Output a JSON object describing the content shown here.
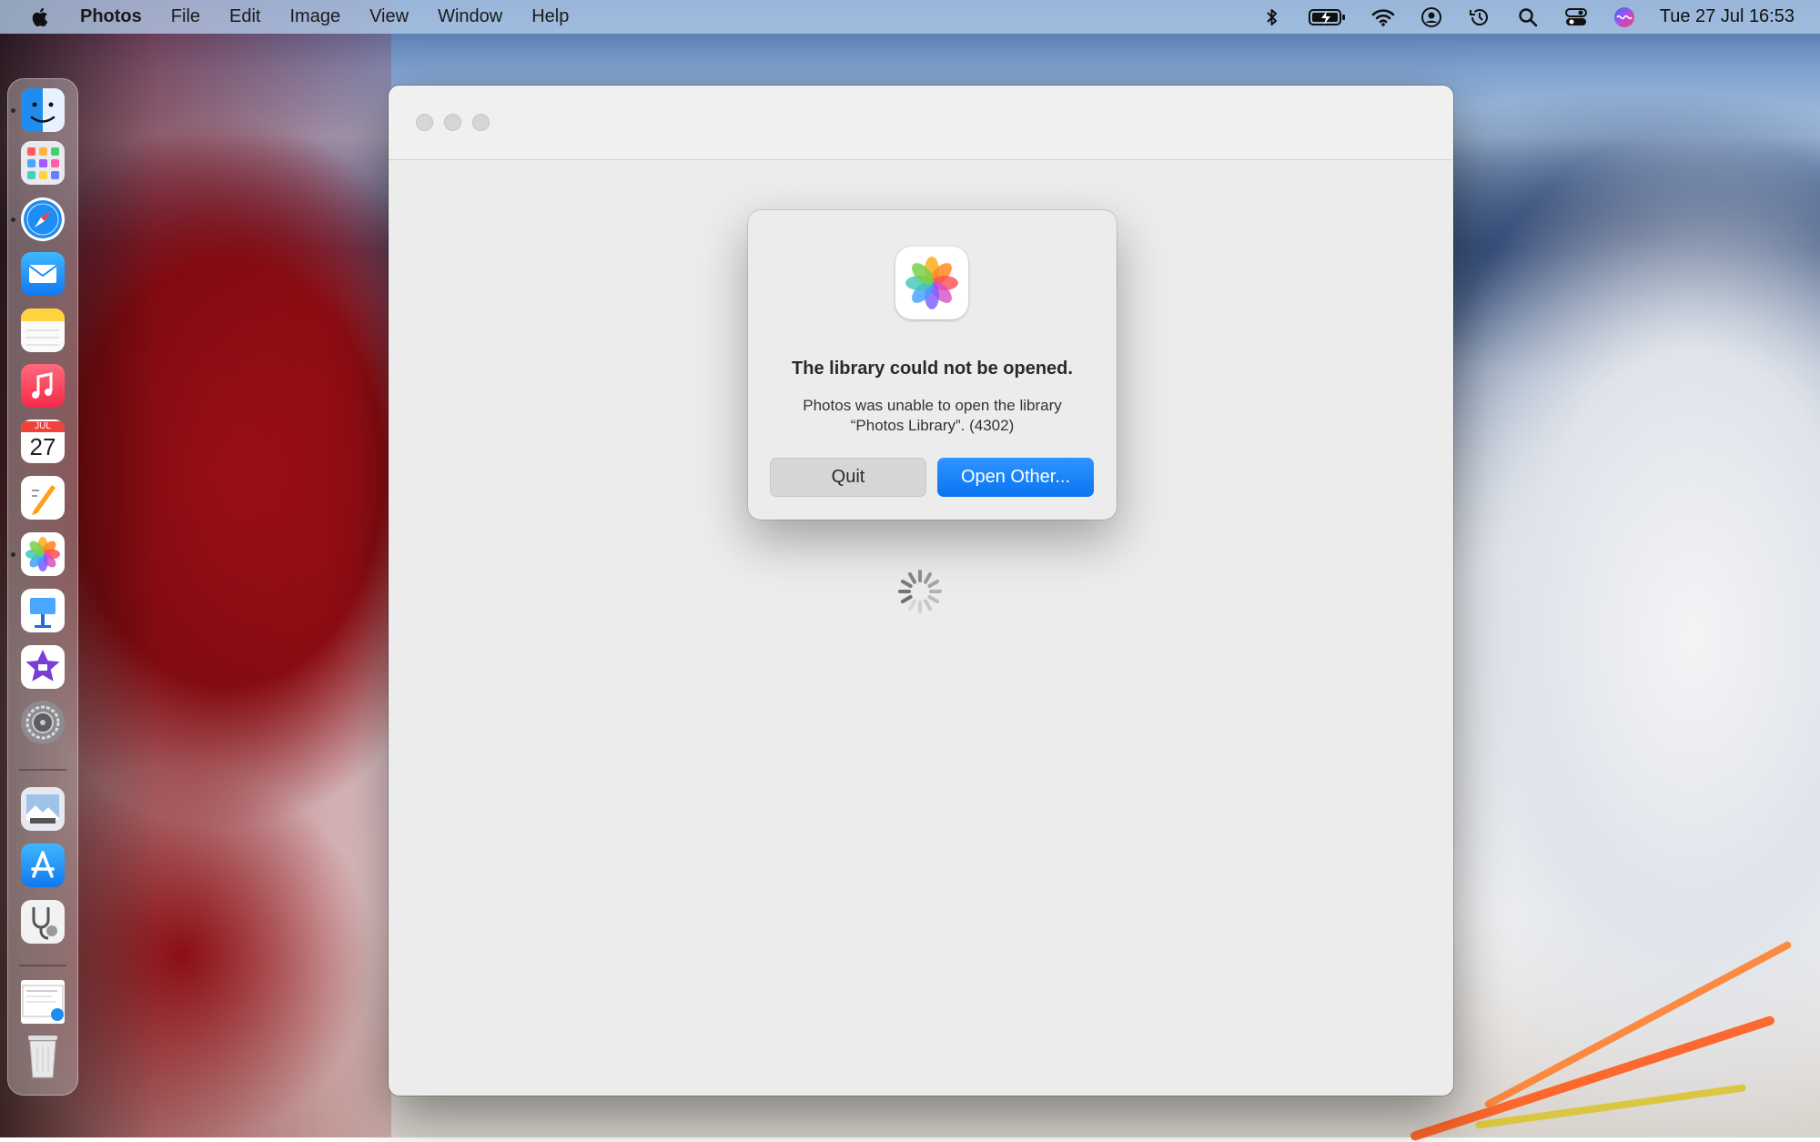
{
  "menubar": {
    "apple_icon": "apple-logo-icon",
    "app_name": "Photos",
    "items": [
      "File",
      "Edit",
      "Image",
      "View",
      "Window",
      "Help"
    ],
    "status_icons": [
      "bluetooth-icon",
      "battery-charging-icon",
      "wifi-icon",
      "user-account-icon",
      "time-machine-icon",
      "spotlight-search-icon",
      "control-center-icon",
      "siri-icon"
    ],
    "clock": "Tue 27 Jul  16:53"
  },
  "dock": {
    "apps": [
      "Finder",
      "Launchpad",
      "Safari",
      "Mail",
      "Notes",
      "Music",
      "Calendar",
      "Pages",
      "Photos",
      "Keynote",
      "iMovie",
      "System Preferences",
      "Preview",
      "App Store",
      "Disk Utility",
      "Document",
      "Trash"
    ],
    "calendar_month": "JUL",
    "calendar_day": "27"
  },
  "alert": {
    "icon": "photos-app-icon",
    "title": "The library could not be opened.",
    "message_line1": "Photos was unable to open the library",
    "message_line2": "“Photos Library”. (4302)",
    "quit_label": "Quit",
    "open_other_label": "Open Other..."
  },
  "colors": {
    "accent": "#0a74f0",
    "menubar": "#b4cdeb",
    "window_bg": "#ececec"
  }
}
